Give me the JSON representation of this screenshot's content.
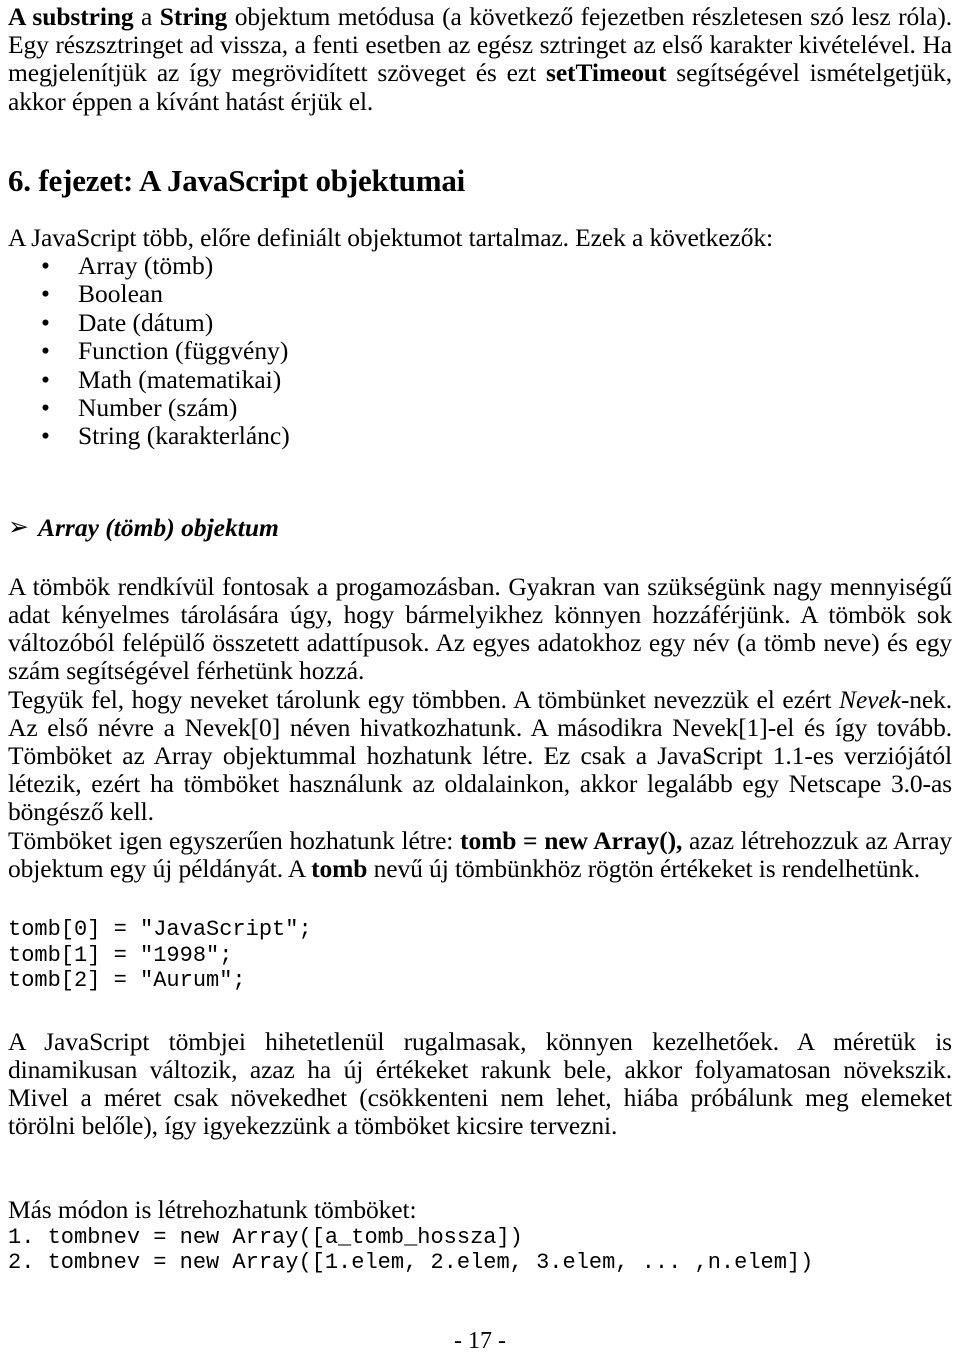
{
  "document": {
    "language": "hu",
    "page_number_label": "- 17 -",
    "background_color": "#ffffff",
    "text_color": "#000000"
  },
  "intro_paragraph": {
    "seg1_bold_a": "A ",
    "seg2_bold": "substring",
    "seg3": " a ",
    "seg4_bold": "String",
    "seg5": " objektum metódusa (a következő fejezetben részletesen szó lesz róla). Egy részsztringet ad vissza, a fenti esetben az egész sztringet az első karakter kivételével. Ha megjelenítjük az így megrövidített szöveget és ezt ",
    "seg6_bold": "setTimeout",
    "seg7": " segítségével ismételgetjük, akkor éppen a kívánt hatást érjük el."
  },
  "chapter": {
    "title": "6. fejezet: A JavaScript objektumai",
    "lead_in": "A JavaScript több, előre definiált objektumot tartalmaz. Ezek a következők:",
    "bullet_glyph": "•",
    "objects": [
      "Array (tömb)",
      "Boolean",
      "Date (dátum)",
      "Function (függvény)",
      "Math (matematikai)",
      "Number (szám)",
      "String (karakterlánc)"
    ]
  },
  "array_section": {
    "arrow_glyph": "➢",
    "heading": "Array (tömb) objektum",
    "para1": "A tömbök rendkívül fontosak a progamozásban. Gyakran van szükségünk nagy mennyiségű adat kényelmes tárolására úgy, hogy bármelyikhez könnyen hozzáférjünk. A tömbök sok változóból felépülő összetett adattípusok. Az egyes adatokhoz egy név (a tömb neve) és egy szám segítségével férhetünk hozzá.",
    "para2_a": "Tegyük fel, hogy neveket tárolunk egy tömbben. A tömbünket nevezzük el ezért ",
    "para2_italic": "Nevek",
    "para2_b": "-nek. Az első névre a Nevek[0] néven hivatkozhatunk. A másodikra Nevek[1]-el és így tovább. Tömböket az Array objektummal hozhatunk létre. Ez csak a JavaScript 1.1-es verziójától létezik, ezért ha tömböket használunk az oldalainkon, akkor legalább egy Netscape 3.0-as böngésző kell.",
    "para3_a": "Tömböket igen egyszerűen hozhatunk létre: ",
    "para3_bold1": "tomb = new Array(),",
    "para3_b": " azaz létrehozzuk az Array objektum egy új példányát. A ",
    "para3_bold2": "tomb",
    "para3_c": " nevű új tömbünkhöz rögtön értékeket is rendelhetünk.",
    "code_block_1": "tomb[0] = \"JavaScript\";\ntomb[1] = \"1998\";\ntomb[2] = \"Aurum\";",
    "para4": "A JavaScript tömbjei hihetetlenül rugalmasak, könnyen kezelhetőek. A méretük is dinamikusan változik, azaz ha új értékeket rakunk bele, akkor folyamatosan növekszik. Mivel a méret csak növekedhet (csökkenteni nem lehet, hiába próbálunk meg elemeket törölni belőle), így igyekezzünk a tömböket kicsire tervezni.",
    "para5": "Más módon is létrehozhatunk tömböket:",
    "code_block_2": "1. tombnev = new Array([a_tomb_hossza])\n2. tombnev = new Array([1.elem, 2.elem, 3.elem, ... ,n.elem])"
  }
}
